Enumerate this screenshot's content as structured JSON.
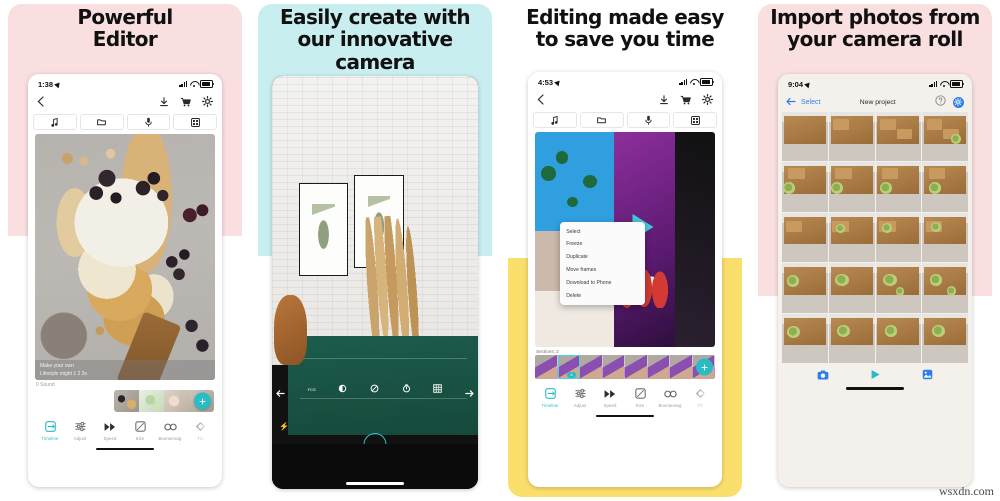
{
  "watermark": "wsxdn.com",
  "panels": [
    {
      "id": "powerful-editor",
      "headline": "Powerful\nEditor",
      "bg_top": "#fadfe0",
      "bg_bottom": "#ffffff",
      "status": {
        "time": "1:38",
        "location_icon": "location-arrow-icon"
      },
      "header": {
        "back": "back-chevron-icon",
        "actions": [
          "download-icon",
          "cart-icon",
          "gear-icon"
        ]
      },
      "chips": [
        "music-note-icon",
        "folder-icon",
        "microphone-icon",
        "grid-icon"
      ],
      "photo_caption": "Make your own\nLifestyle might 1 2 3s",
      "sound_label": "0 Sound",
      "add_button": "+",
      "toolbar": [
        {
          "label": "Timeline",
          "icon": "timeline-icon",
          "active": true
        },
        {
          "label": "Adjust",
          "icon": "adjust-icon",
          "active": false
        },
        {
          "label": "Speed",
          "icon": "speed-icon",
          "active": false
        },
        {
          "label": "Size",
          "icon": "size-icon",
          "active": false
        },
        {
          "label": "Boomerang",
          "icon": "boomerang-icon",
          "active": false
        },
        {
          "label": "Tilt",
          "icon": "tilt-icon",
          "active": false
        }
      ]
    },
    {
      "id": "innovative-camera",
      "headline": "Easily create with\nour innovative\ncamera",
      "bg_top": "#c9eef0",
      "bg_bottom": "#ffffff",
      "camera_controls": {
        "prev": "arrow-left-icon",
        "next": "arrow-right-icon",
        "focus_label": "FCS",
        "items": [
          "exposure-icon",
          "no-flash-icon",
          "timer-icon",
          "grid-icon"
        ],
        "flash": "bolt-icon",
        "shutter": "shutter-button"
      }
    },
    {
      "id": "editing-made-easy",
      "headline": "Editing made easy\nto save you time",
      "bg_top": "#ffffff",
      "bg_bottom": "#fadf6c",
      "status": {
        "time": "4:53",
        "location_icon": "location-arrow-icon"
      },
      "header": {
        "back": "back-chevron-icon",
        "actions": [
          "download-icon",
          "cart-icon",
          "gear-icon"
        ]
      },
      "chips": [
        "music-note-icon",
        "folder-icon",
        "microphone-icon",
        "grid-icon"
      ],
      "context_menu": [
        "Select",
        "Freeze",
        "Duplicate",
        "Move frames",
        "Download to Phone",
        "Delete"
      ],
      "clip_label": "Sections: 2",
      "frame_badge": "4",
      "add_button": "+",
      "toolbar": [
        {
          "label": "Timeline",
          "icon": "timeline-icon",
          "active": true
        },
        {
          "label": "Adjust",
          "icon": "adjust-icon",
          "active": false
        },
        {
          "label": "Speed",
          "icon": "speed-icon",
          "active": false
        },
        {
          "label": "Size",
          "icon": "size-icon",
          "active": false
        },
        {
          "label": "Boomerang",
          "icon": "boomerang-icon",
          "active": false
        },
        {
          "label": "Tilt",
          "icon": "tilt-icon",
          "active": false
        }
      ]
    },
    {
      "id": "import-photos",
      "headline": "Import photos from\nyour camera roll",
      "bg_top": "#fadfe0",
      "bg_bottom": "#ffffff",
      "status": {
        "time": "9:04",
        "location_icon": "location-arrow-icon"
      },
      "header": {
        "back": "arrow-left-icon",
        "select_label": "Select",
        "title": "New project",
        "help": "help-circle-icon",
        "settings": "gear-icon"
      },
      "footer": [
        "camera-icon",
        "play-icon",
        "photos-icon"
      ],
      "grid_rows": 5,
      "grid_cols": 4
    }
  ],
  "colors": {
    "accent_teal": "#29bcc4",
    "accent_blue": "#2f7fe8",
    "pink": "#fadfe0",
    "mint": "#c9eef0",
    "yellow": "#fadf6c"
  }
}
